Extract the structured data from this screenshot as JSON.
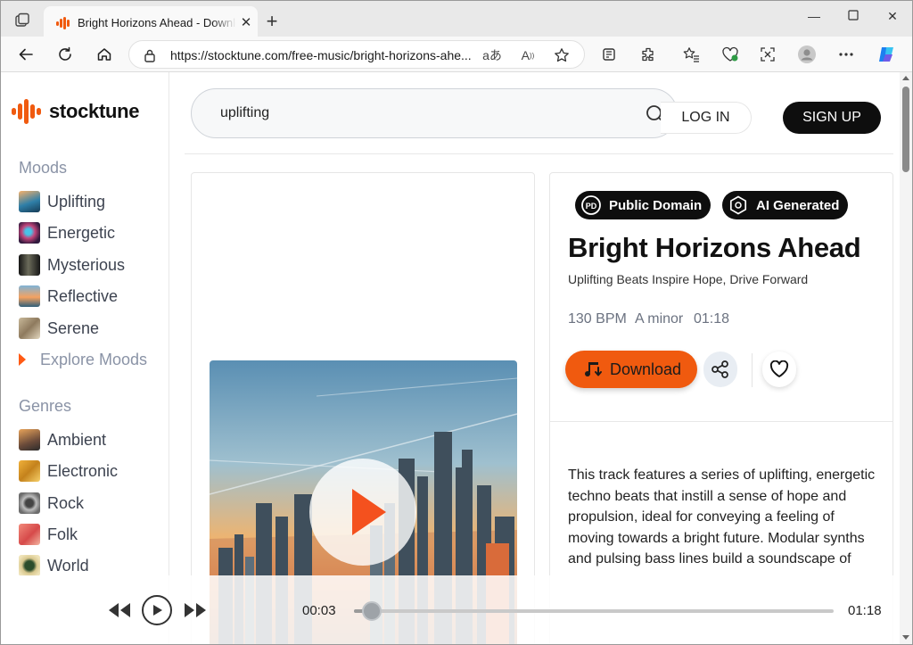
{
  "browser": {
    "tab_title": "Bright Horizons Ahead - Download",
    "url": "https://stocktune.com/free-music/bright-horizons-ahe...",
    "window_controls": [
      "minimize",
      "maximize",
      "close"
    ]
  },
  "site": {
    "brand": "stocktune",
    "accent": "#f05a0f",
    "search": {
      "value": "uplifting"
    },
    "login_label": "LOG IN",
    "signup_label": "SIGN UP"
  },
  "sidebar": {
    "moods_title": "Moods",
    "moods": [
      {
        "label": "Uplifting"
      },
      {
        "label": "Energetic"
      },
      {
        "label": "Mysterious"
      },
      {
        "label": "Reflective"
      },
      {
        "label": "Serene"
      }
    ],
    "explore_label": "Explore Moods",
    "genres_title": "Genres",
    "genres": [
      {
        "label": "Ambient"
      },
      {
        "label": "Electronic"
      },
      {
        "label": "Rock"
      },
      {
        "label": "Folk"
      },
      {
        "label": "World"
      }
    ]
  },
  "track": {
    "badges": [
      "Public Domain",
      "AI Generated"
    ],
    "title": "Bright Horizons Ahead",
    "subtitle": "Uplifting Beats Inspire Hope, Drive Forward",
    "bpm": "130 BPM",
    "key": "A minor",
    "duration": "01:18",
    "download_label": "Download",
    "description": "This track features a series of uplifting, energetic techno beats that instill a sense of hope and propulsion, ideal for conveying a feeling of moving towards a bright future. Modular synths and pulsing bass lines build a soundscape of"
  },
  "player": {
    "current_time": "00:03",
    "total_time": "01:18",
    "progress": 0.038
  }
}
